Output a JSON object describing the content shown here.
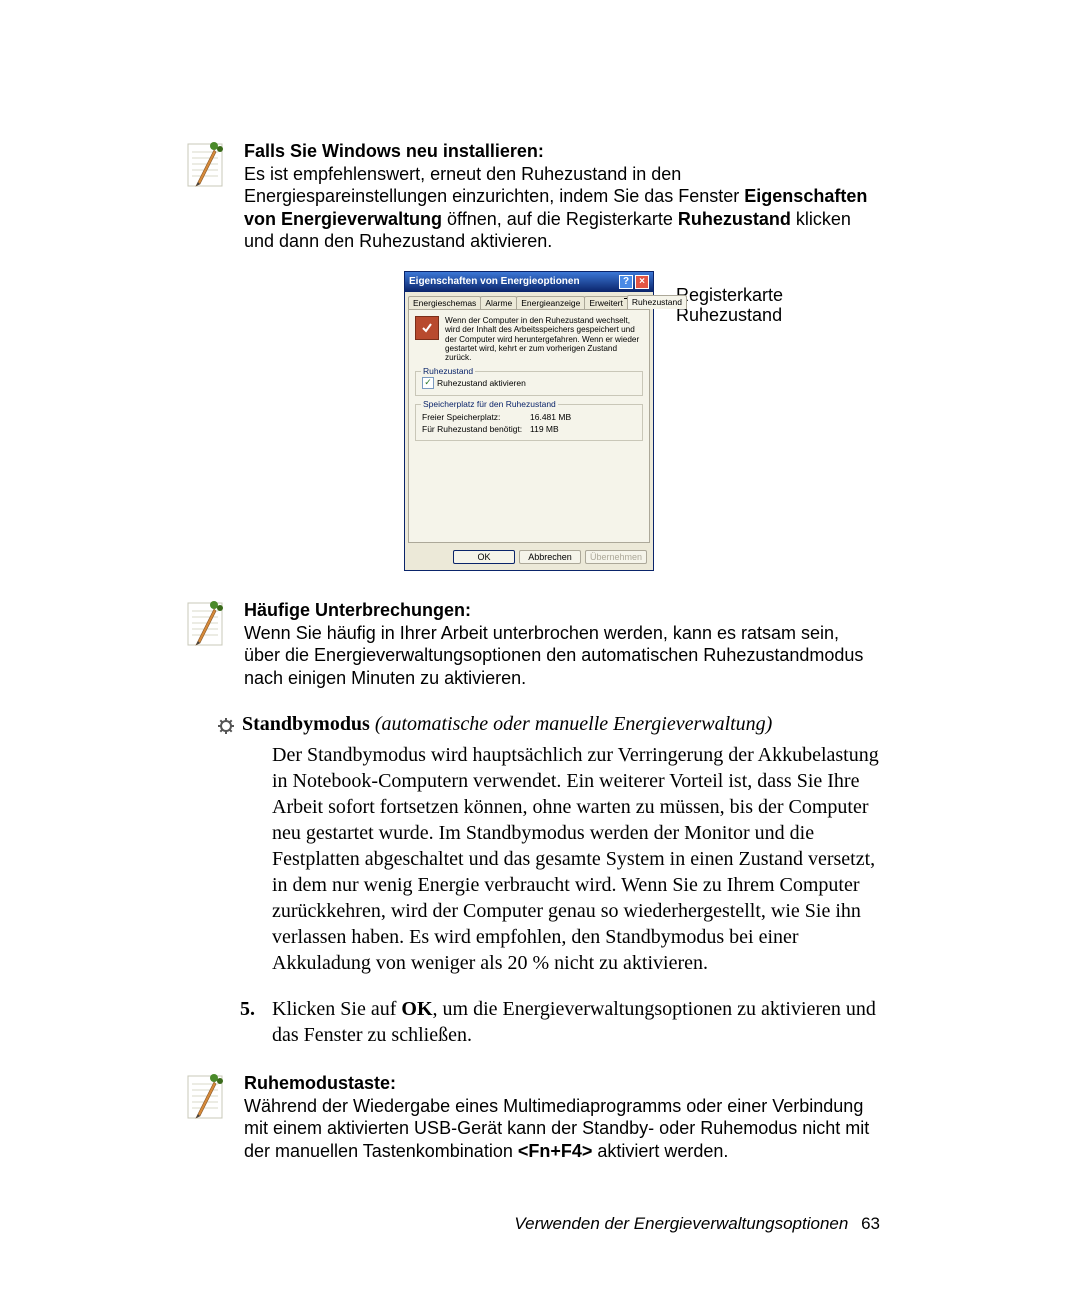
{
  "note1": {
    "title": "Falls Sie Windows neu installieren:",
    "line1": "Es ist empfehlenswert, erneut den Ruhezustand in den Energiespareinstellungen einzurichten, indem Sie das Fenster ",
    "bold1": "Eigenschaften von Energieverwaltung",
    "line2": " öffnen, auf die Registerkarte ",
    "bold2": "Ruhezustand",
    "line3": " klicken und dann den Ruhezustand aktivieren."
  },
  "dialog": {
    "title": "Eigenschaften von Energieoptionen",
    "tabs": {
      "t0": "Energieschemas",
      "t1": "Alarme",
      "t2": "Energieanzeige",
      "t3": "Erweitert",
      "t4": "Ruhezustand"
    },
    "desc": "Wenn der Computer in den Ruhezustand wechselt, wird der Inhalt des Arbeitsspeichers gespeichert und der Computer wird heruntergefahren. Wenn er wieder gestartet wird, kehrt er zum vorherigen Zustand zurück.",
    "fieldset1": {
      "legend": "Ruhezustand",
      "checkbox": "Ruhezustand aktivieren"
    },
    "fieldset2": {
      "legend": "Speicherplatz für den Ruhezustand",
      "free_label": "Freier Speicherplatz:",
      "free_value": "16.481 MB",
      "need_label": "Für Ruhezustand benötigt:",
      "need_value": "119 MB"
    },
    "buttons": {
      "ok": "OK",
      "cancel": "Abbrechen",
      "apply": "Übernehmen"
    }
  },
  "callout": {
    "line1": "Registerkarte",
    "line2": "Ruhezustand"
  },
  "note2": {
    "title": "Häufige Unterbrechungen:",
    "text": "Wenn Sie häufig in Ihrer Arbeit unterbrochen werden, kann es ratsam sein, über die Energieverwaltungsoptionen den automatischen Ruhezustandmodus nach einigen Minuten zu aktivieren."
  },
  "section": {
    "title": "Standbymodus",
    "subtitle": " (automatische oder manuelle Energieverwaltung)"
  },
  "body": "Der Standbymodus wird hauptsächlich zur Verringerung der Akkubelastung in Notebook-Computern verwendet. Ein weiterer Vorteil ist, dass Sie Ihre Arbeit sofort fortsetzen können, ohne warten zu müssen, bis der Computer neu gestartet wurde. Im Standbymodus werden der Monitor und die Festplatten abgeschaltet und das gesamte System in einen Zustand versetzt, in dem nur wenig Energie verbraucht wird. Wenn Sie zu Ihrem Computer zurückkehren, wird der Computer genau so wiederhergestellt, wie Sie ihn verlassen haben. Es wird empfohlen, den Standbymodus bei einer Akkuladung von weniger als 20 % nicht zu aktivieren.",
  "step5": {
    "num": "5.",
    "pre": "Klicken Sie auf ",
    "bold": "OK",
    "post": ", um die Energieverwaltungsoptionen zu aktivieren und das Fenster zu schließen."
  },
  "note3": {
    "title": "Ruhemodustaste:",
    "pre": "Während der Wiedergabe eines Multimediaprogramms oder einer Verbindung mit einem aktivierten USB-Gerät kann der Standby- oder Ruhemodus nicht mit der manuellen Tastenkombination ",
    "bold": "<Fn+F4>",
    "post": " aktiviert werden."
  },
  "footer": {
    "text": "Verwenden der Energieverwaltungsoptionen",
    "page": "63"
  }
}
